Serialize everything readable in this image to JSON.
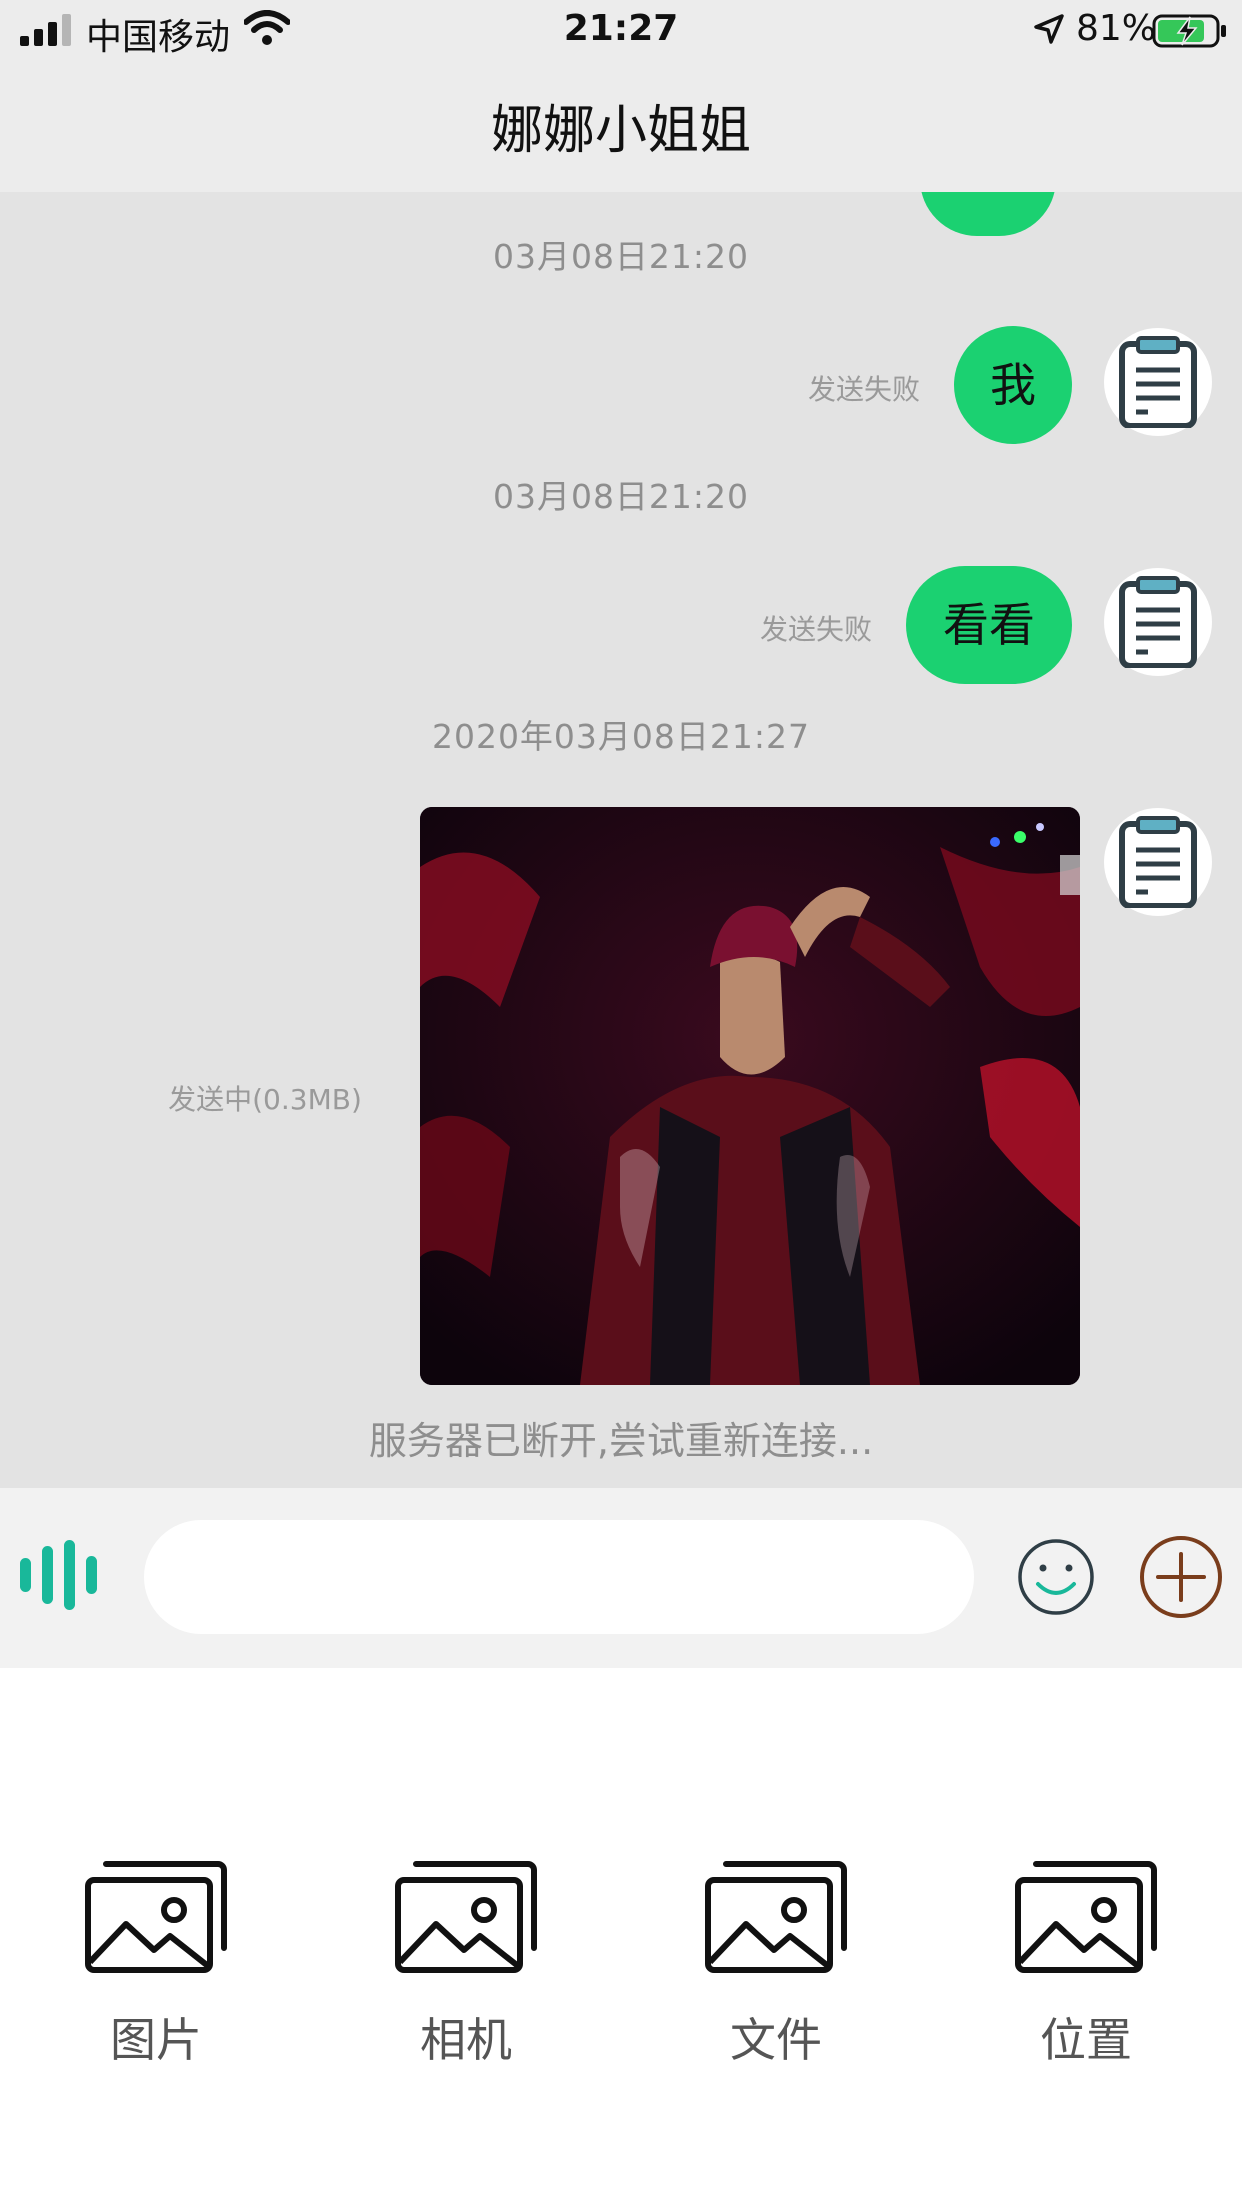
{
  "status_bar": {
    "carrier": "中国移动",
    "time": "21:27",
    "battery": "81%"
  },
  "nav": {
    "title": "娜娜小姐姐"
  },
  "messages": {
    "timestamp_1": "03月08日21:20",
    "msg_1": {
      "text": "我",
      "status": "发送失败"
    },
    "timestamp_2": "03月08日21:20",
    "msg_2": {
      "text": "看看",
      "status": "发送失败"
    },
    "timestamp_3": "2020年03月08日21:27",
    "msg_3": {
      "status": "发送中(0.3MB)"
    }
  },
  "notice": "服务器已断开,尝试重新连接...",
  "input": {
    "placeholder": ""
  },
  "panel": {
    "actions": [
      {
        "label": "图片",
        "icon": "picture-icon"
      },
      {
        "label": "相机",
        "icon": "picture-icon"
      },
      {
        "label": "文件",
        "icon": "picture-icon"
      },
      {
        "label": "位置",
        "icon": "picture-icon"
      }
    ]
  },
  "colors": {
    "bubble": "#1bd171",
    "chat_bg": "#e3e3e3",
    "voice_icon": "#19b89a",
    "plus_icon": "#7a3d1c"
  }
}
